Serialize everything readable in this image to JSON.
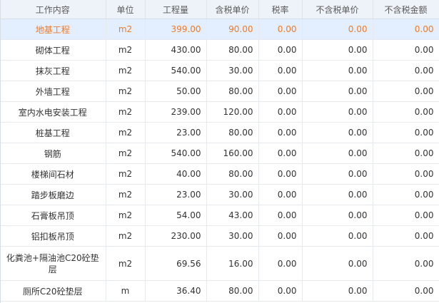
{
  "columns": [
    "工作内容",
    "单位",
    "工程量",
    "含税单价",
    "税率",
    "不含税单价",
    "不含税金额"
  ],
  "rows": [
    {
      "name": "地基工程",
      "unit": "m2",
      "qty": "399.00",
      "price": "90.00",
      "tax": "0.00",
      "net_price": "0.00",
      "net_amount": "0.00",
      "selected": true
    },
    {
      "name": "砌体工程",
      "unit": "m2",
      "qty": "430.00",
      "price": "80.00",
      "tax": "0.00",
      "net_price": "0.00",
      "net_amount": "0.00"
    },
    {
      "name": "抹灰工程",
      "unit": "m2",
      "qty": "540.00",
      "price": "30.00",
      "tax": "0.00",
      "net_price": "0.00",
      "net_amount": "0.00"
    },
    {
      "name": "外墙工程",
      "unit": "m2",
      "qty": "50.00",
      "price": "80.00",
      "tax": "0.00",
      "net_price": "0.00",
      "net_amount": "0.00"
    },
    {
      "name": "室内水电安装工程",
      "unit": "m2",
      "qty": "239.00",
      "price": "120.00",
      "tax": "0.00",
      "net_price": "0.00",
      "net_amount": "0.00"
    },
    {
      "name": "桩基工程",
      "unit": "m2",
      "qty": "23.00",
      "price": "80.00",
      "tax": "0.00",
      "net_price": "0.00",
      "net_amount": "0.00"
    },
    {
      "name": "钢筋",
      "unit": "m2",
      "qty": "540.00",
      "price": "160.00",
      "tax": "0.00",
      "net_price": "0.00",
      "net_amount": "0.00"
    },
    {
      "name": "楼梯间石材",
      "unit": "m2",
      "qty": "40.00",
      "price": "80.00",
      "tax": "0.00",
      "net_price": "0.00",
      "net_amount": "0.00"
    },
    {
      "name": "踏步板磨边",
      "unit": "m2",
      "qty": "23.00",
      "price": "30.00",
      "tax": "0.00",
      "net_price": "0.00",
      "net_amount": "0.00"
    },
    {
      "name": "石膏板吊顶",
      "unit": "m2",
      "qty": "54.00",
      "price": "43.00",
      "tax": "0.00",
      "net_price": "0.00",
      "net_amount": "0.00"
    },
    {
      "name": "铝扣板吊顶",
      "unit": "m2",
      "qty": "230.00",
      "price": "30.00",
      "tax": "0.00",
      "net_price": "0.00",
      "net_amount": "0.00"
    },
    {
      "name": "化粪池+隔油池C20砼垫层",
      "unit": "m2",
      "qty": "69.56",
      "price": "16.00",
      "tax": "0.00",
      "net_price": "0.00",
      "net_amount": "0.00",
      "tall": true
    },
    {
      "name": "厕所C20砼垫层",
      "unit": "m",
      "qty": "36.40",
      "price": "80.00",
      "tax": "0.00",
      "net_price": "0.00",
      "net_amount": "0.00"
    }
  ]
}
